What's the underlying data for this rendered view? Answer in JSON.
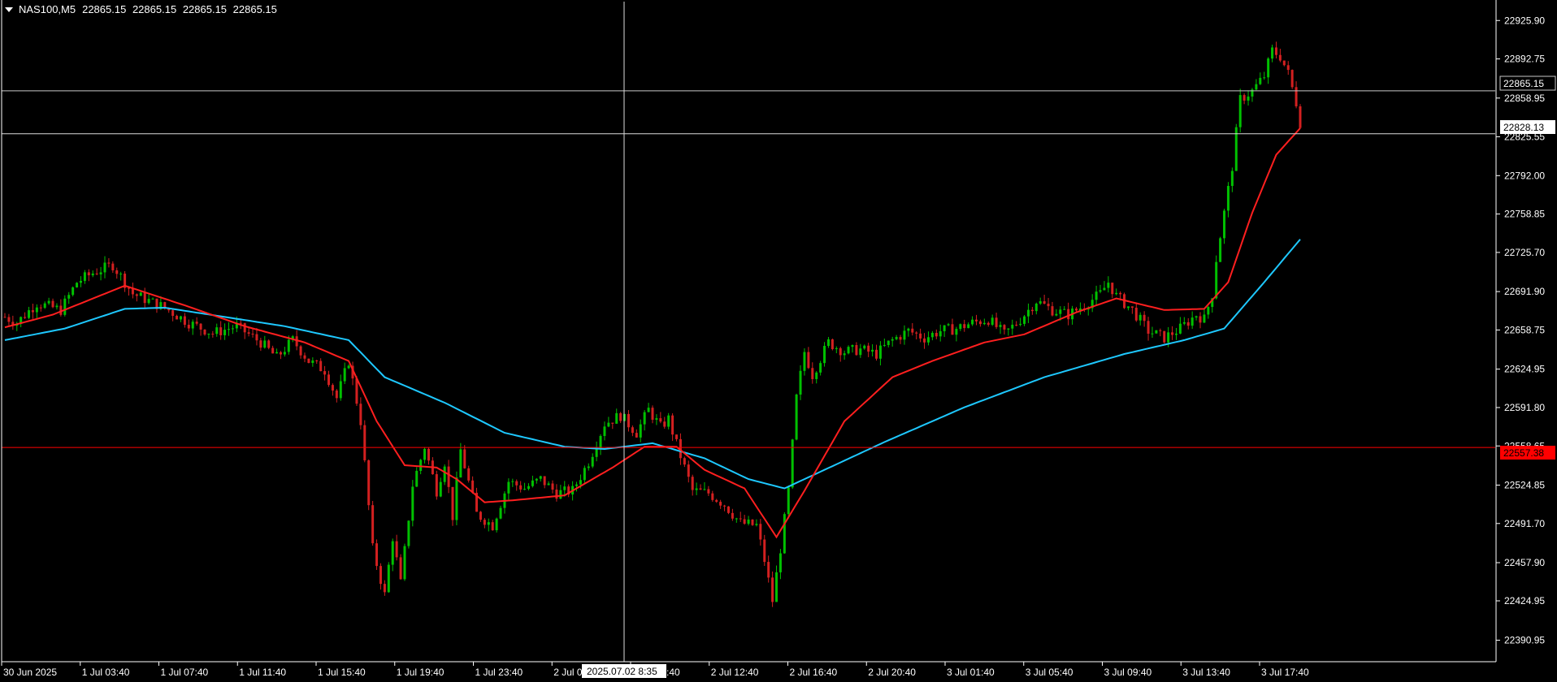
{
  "header": {
    "symbol": "NAS100,M5",
    "prices": [
      "22865.15",
      "22865.15",
      "22865.15",
      "22865.15"
    ]
  },
  "colors": {
    "background": "#000000",
    "bull": "#00c000",
    "bear": "#d32020",
    "ma_fast": "#ff1f1f",
    "ma_slow": "#1ec8ff",
    "axis": "#ffffff",
    "crosshair": "#c0c0c0",
    "level": "#ff0000"
  },
  "price_labels": {
    "current": "22865.15",
    "crosshair": "22828.13",
    "level": "22557.38"
  },
  "crosshair_time": "2025.07.02 8:35",
  "chart_data": {
    "type": "candlestick",
    "ylim": [
      22374.5,
      22942.2
    ],
    "y_ticks": [
      "22925.90",
      "22892.75",
      "22858.95",
      "22825.55",
      "22792.00",
      "22758.85",
      "22725.70",
      "22691.90",
      "22658.75",
      "22624.95",
      "22591.80",
      "22558.65",
      "22524.85",
      "22491.70",
      "22457.90",
      "22424.95",
      "22390.95"
    ],
    "x_ticks": [
      "30 Jun 2025",
      "1 Jul 03:40",
      "1 Jul 07:40",
      "1 Jul 11:40",
      "1 Jul 15:40",
      "1 Jul 19:40",
      "1 Jul 23:40",
      "2 Jul 04:40",
      "2 Jul 08:40",
      "2 Jul 12:40",
      "2 Jul 16:40",
      "2 Jul 20:40",
      "3 Jul 01:40",
      "3 Jul 05:40",
      "3 Jul 09:40",
      "3 Jul 13:40",
      "3 Jul 17:40"
    ],
    "price_anchors": [
      [
        0,
        22670
      ],
      [
        3,
        22665
      ],
      [
        8,
        22682
      ],
      [
        14,
        22676
      ],
      [
        18,
        22700
      ],
      [
        22,
        22708
      ],
      [
        27,
        22715
      ],
      [
        32,
        22690
      ],
      [
        40,
        22678
      ],
      [
        46,
        22665
      ],
      [
        52,
        22656
      ],
      [
        58,
        22662
      ],
      [
        64,
        22648
      ],
      [
        68,
        22635
      ],
      [
        72,
        22650
      ],
      [
        76,
        22632
      ],
      [
        80,
        22624
      ],
      [
        83,
        22600
      ],
      [
        86,
        22632
      ],
      [
        89,
        22580
      ],
      [
        92,
        22470
      ],
      [
        95,
        22430
      ],
      [
        97,
        22480
      ],
      [
        99,
        22440
      ],
      [
        102,
        22525
      ],
      [
        105,
        22558
      ],
      [
        108,
        22520
      ],
      [
        110,
        22545
      ],
      [
        112,
        22498
      ],
      [
        114,
        22555
      ],
      [
        118,
        22500
      ],
      [
        122,
        22490
      ],
      [
        126,
        22528
      ],
      [
        130,
        22522
      ],
      [
        134,
        22530
      ],
      [
        138,
        22518
      ],
      [
        142,
        22520
      ],
      [
        146,
        22545
      ],
      [
        150,
        22578
      ],
      [
        154,
        22585
      ],
      [
        158,
        22570
      ],
      [
        161,
        22590
      ],
      [
        164,
        22575
      ],
      [
        166,
        22582
      ],
      [
        168,
        22560
      ],
      [
        172,
        22520
      ],
      [
        176,
        22518
      ],
      [
        180,
        22508
      ],
      [
        184,
        22492
      ],
      [
        188,
        22490
      ],
      [
        190,
        22460
      ],
      [
        192,
        22425
      ],
      [
        194,
        22470
      ],
      [
        196,
        22520
      ],
      [
        198,
        22600
      ],
      [
        200,
        22640
      ],
      [
        202,
        22620
      ],
      [
        206,
        22648
      ],
      [
        210,
        22640
      ],
      [
        214,
        22642
      ],
      [
        218,
        22638
      ],
      [
        222,
        22650
      ],
      [
        226,
        22658
      ],
      [
        230,
        22652
      ],
      [
        234,
        22658
      ],
      [
        238,
        22660
      ],
      [
        242,
        22665
      ],
      [
        246,
        22668
      ],
      [
        250,
        22655
      ],
      [
        254,
        22668
      ],
      [
        258,
        22684
      ],
      [
        262,
        22676
      ],
      [
        266,
        22672
      ],
      [
        270,
        22680
      ],
      [
        274,
        22690
      ],
      [
        276,
        22700
      ],
      [
        278,
        22688
      ],
      [
        282,
        22676
      ],
      [
        286,
        22658
      ],
      [
        290,
        22652
      ],
      [
        294,
        22660
      ],
      [
        298,
        22672
      ],
      [
        300,
        22668
      ],
      [
        302,
        22690
      ],
      [
        303,
        22720
      ],
      [
        305,
        22760
      ],
      [
        307,
        22800
      ],
      [
        309,
        22858
      ],
      [
        312,
        22865
      ],
      [
        315,
        22878
      ],
      [
        317,
        22900
      ],
      [
        319,
        22895
      ],
      [
        321,
        22880
      ],
      [
        323,
        22855
      ],
      [
        324,
        22838
      ]
    ],
    "ma_fast": [
      [
        0,
        22661
      ],
      [
        12,
        22672
      ],
      [
        30,
        22697
      ],
      [
        45,
        22680
      ],
      [
        60,
        22662
      ],
      [
        75,
        22648
      ],
      [
        86,
        22632
      ],
      [
        93,
        22580
      ],
      [
        100,
        22542
      ],
      [
        108,
        22540
      ],
      [
        113,
        22530
      ],
      [
        120,
        22510
      ],
      [
        128,
        22512
      ],
      [
        140,
        22516
      ],
      [
        152,
        22540
      ],
      [
        160,
        22558
      ],
      [
        168,
        22558
      ],
      [
        175,
        22538
      ],
      [
        185,
        22522
      ],
      [
        193,
        22480
      ],
      [
        200,
        22520
      ],
      [
        210,
        22580
      ],
      [
        222,
        22618
      ],
      [
        232,
        22632
      ],
      [
        245,
        22648
      ],
      [
        255,
        22655
      ],
      [
        268,
        22674
      ],
      [
        278,
        22686
      ],
      [
        290,
        22676
      ],
      [
        300,
        22677
      ],
      [
        306,
        22700
      ],
      [
        312,
        22760
      ],
      [
        318,
        22810
      ],
      [
        324,
        22833
      ]
    ],
    "ma_slow": [
      [
        0,
        22650
      ],
      [
        15,
        22660
      ],
      [
        30,
        22677
      ],
      [
        40,
        22678
      ],
      [
        55,
        22670
      ],
      [
        70,
        22662
      ],
      [
        86,
        22650
      ],
      [
        95,
        22618
      ],
      [
        110,
        22596
      ],
      [
        125,
        22570
      ],
      [
        140,
        22558
      ],
      [
        150,
        22556
      ],
      [
        162,
        22561
      ],
      [
        175,
        22548
      ],
      [
        186,
        22530
      ],
      [
        195,
        22522
      ],
      [
        205,
        22538
      ],
      [
        220,
        22562
      ],
      [
        240,
        22592
      ],
      [
        260,
        22618
      ],
      [
        280,
        22638
      ],
      [
        295,
        22650
      ],
      [
        305,
        22660
      ],
      [
        315,
        22700
      ],
      [
        324,
        22737
      ]
    ],
    "levels": {
      "current": 22865.15,
      "crosshair": 22828.13,
      "level": 22557.38
    },
    "bars": 325,
    "grid": false
  }
}
